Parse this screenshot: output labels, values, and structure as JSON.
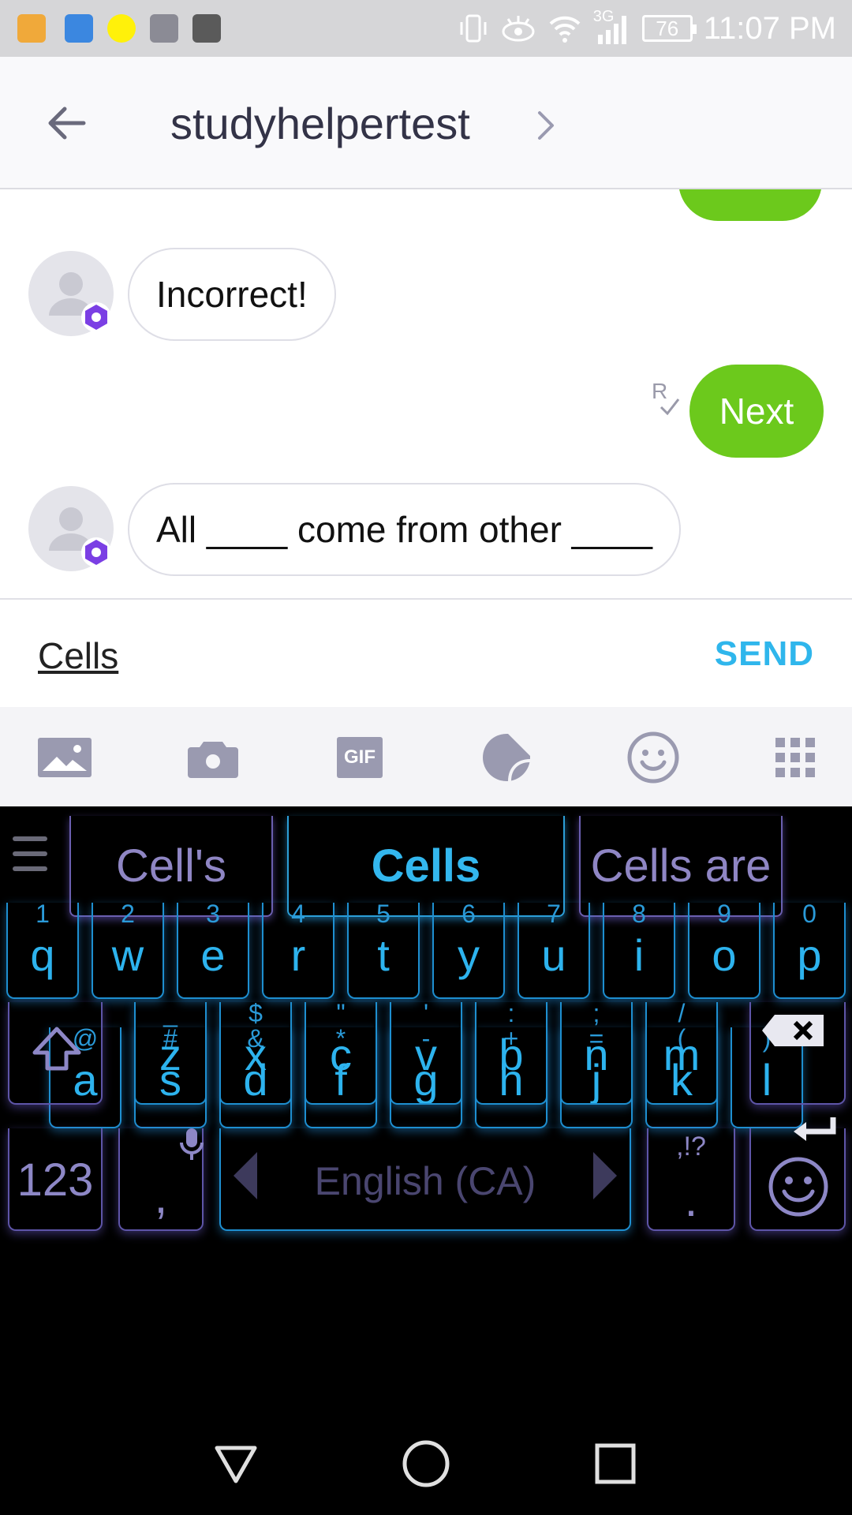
{
  "status_bar": {
    "app_icons": [
      "keyboard-app-icon",
      "health-app-icon",
      "snapchat-icon",
      "gallery-icon",
      "kynz-icon"
    ],
    "network": "3G",
    "battery": "76",
    "time": "11:07 PM"
  },
  "header": {
    "title": "studyhelpertest"
  },
  "messages": [
    {
      "side": "in",
      "text": "Incorrect!"
    },
    {
      "side": "out",
      "text": "Next",
      "read_mark": "R"
    },
    {
      "side": "in",
      "text": "All ____ come from other ____"
    }
  ],
  "input": {
    "value": "Cells",
    "send_label": "SEND"
  },
  "attach_toolbar": [
    "image-icon",
    "camera-icon",
    "gif-icon",
    "sticker-icon",
    "emoji-icon",
    "apps-grid-icon"
  ],
  "gif_label": "GIF",
  "keyboard": {
    "suggestions": [
      "Cell's",
      "Cells",
      "Cells are"
    ],
    "row1": [
      {
        "k": "q",
        "h": "1"
      },
      {
        "k": "w",
        "h": "2"
      },
      {
        "k": "e",
        "h": "3"
      },
      {
        "k": "r",
        "h": "4"
      },
      {
        "k": "t",
        "h": "5"
      },
      {
        "k": "y",
        "h": "6"
      },
      {
        "k": "u",
        "h": "7"
      },
      {
        "k": "i",
        "h": "8"
      },
      {
        "k": "o",
        "h": "9"
      },
      {
        "k": "p",
        "h": "0"
      }
    ],
    "row2": [
      {
        "k": "a",
        "h": "@"
      },
      {
        "k": "s",
        "h": "#"
      },
      {
        "k": "d",
        "h": "&"
      },
      {
        "k": "f",
        "h": "*"
      },
      {
        "k": "g",
        "h": "-"
      },
      {
        "k": "h",
        "h": "+"
      },
      {
        "k": "j",
        "h": "="
      },
      {
        "k": "k",
        "h": "("
      },
      {
        "k": "l",
        "h": ")"
      }
    ],
    "row3": [
      {
        "k": "z",
        "h": "_"
      },
      {
        "k": "x",
        "h": "$"
      },
      {
        "k": "c",
        "h": "\""
      },
      {
        "k": "v",
        "h": "'"
      },
      {
        "k": "b",
        "h": ":"
      },
      {
        "k": "n",
        "h": ";"
      },
      {
        "k": "m",
        "h": "/"
      }
    ],
    "mode_key": "123",
    "comma_key": ",",
    "space_label": "English (CA)",
    "period_key": ".",
    "period_hint": ",!?"
  },
  "colors": {
    "accent_green": "#6cc91c",
    "send_blue": "#2fb6ec",
    "key_blue": "#2db3ee",
    "key_purple": "#8d87c6",
    "badge_purple": "#7b3fe4"
  }
}
